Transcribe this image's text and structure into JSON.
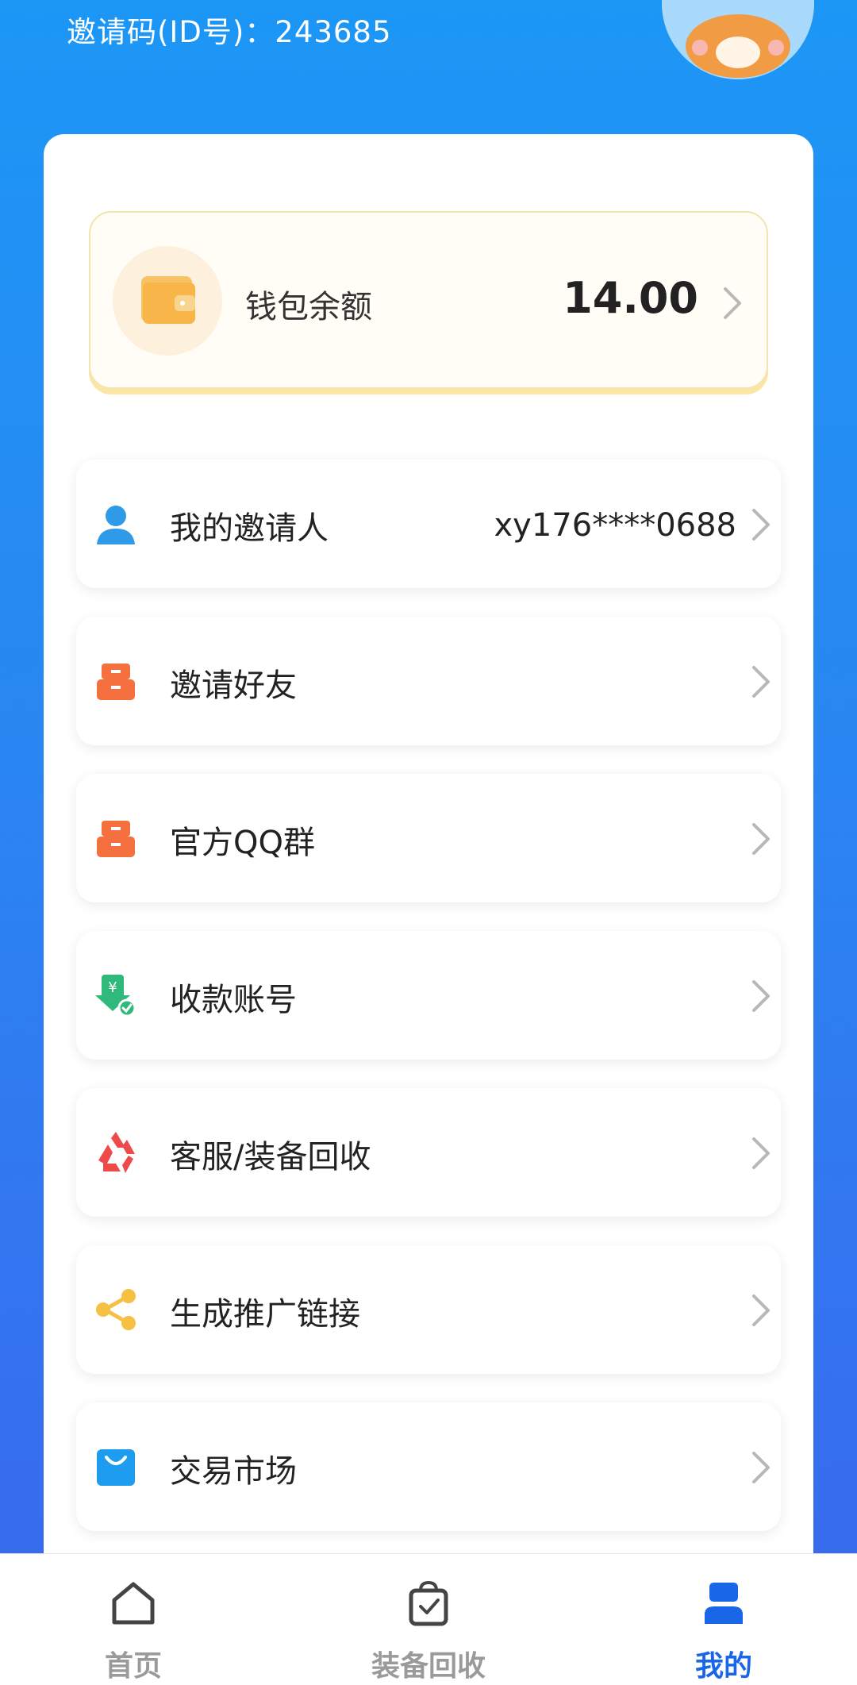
{
  "header": {
    "invite_code": "邀请码(ID号)：243685"
  },
  "wallet": {
    "label": "钱包余额",
    "amount": "14.00"
  },
  "menu": [
    {
      "label": "我的邀请人",
      "value": "xy176****0688",
      "icon": "user-icon"
    },
    {
      "label": "邀请好友",
      "value": "",
      "icon": "archive-box-icon"
    },
    {
      "label": "官方QQ群",
      "value": "",
      "icon": "archive-box-icon"
    },
    {
      "label": "收款账号",
      "value": "",
      "icon": "payment-account-icon"
    },
    {
      "label": "客服/装备回收",
      "value": "",
      "icon": "recycle-icon"
    },
    {
      "label": "生成推广链接",
      "value": "",
      "icon": "share-icon"
    },
    {
      "label": "交易市场",
      "value": "",
      "icon": "shopping-bag-icon"
    }
  ],
  "tabbar": {
    "tabs": [
      {
        "label": "首页",
        "icon": "home-icon",
        "active": false
      },
      {
        "label": "装备回收",
        "icon": "recycle-bag-icon",
        "active": false
      },
      {
        "label": "我的",
        "icon": "profile-icon",
        "active": true
      }
    ]
  },
  "colors": {
    "accent": "#1a66e8",
    "background_top": "#1c97f6",
    "background_bottom": "#3a67ee"
  }
}
